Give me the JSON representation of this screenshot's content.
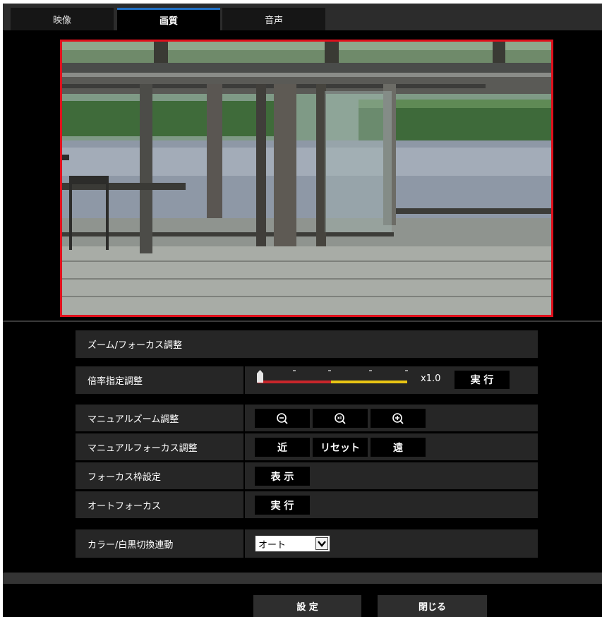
{
  "tabs": [
    {
      "label": "映像",
      "active": false
    },
    {
      "label": "画質",
      "active": true
    },
    {
      "label": "音声",
      "active": false
    }
  ],
  "panel": {
    "title": "ズーム/フォーカス調整",
    "zoom_ratio": {
      "label": "倍率指定調整",
      "value_text": "x1.0",
      "execute_label": "実 行",
      "slider_level": 0.0
    },
    "manual_zoom": {
      "label": "マニュアルズーム調整",
      "buttons": [
        "zoom-out-icon",
        "zoom-reset-x1-icon",
        "zoom-in-icon"
      ]
    },
    "manual_focus": {
      "label": "マニュアルフォーカス調整",
      "near_label": "近",
      "reset_label": "リセット",
      "far_label": "遠"
    },
    "focus_frame": {
      "label": "フォーカス枠設定",
      "button_label": "表 示"
    },
    "auto_focus": {
      "label": "オートフォーカス",
      "button_label": "実 行"
    },
    "color_bw": {
      "label": "カラー/白黒切換連動",
      "selected": "オート"
    }
  },
  "footer": {
    "set_label": "設 定",
    "close_label": "閉じる"
  },
  "colors": {
    "accent_tab": "#1f6fc5",
    "preview_border": "#e0101c",
    "slider_red": "#c8262b",
    "slider_yellow": "#e8c414"
  }
}
